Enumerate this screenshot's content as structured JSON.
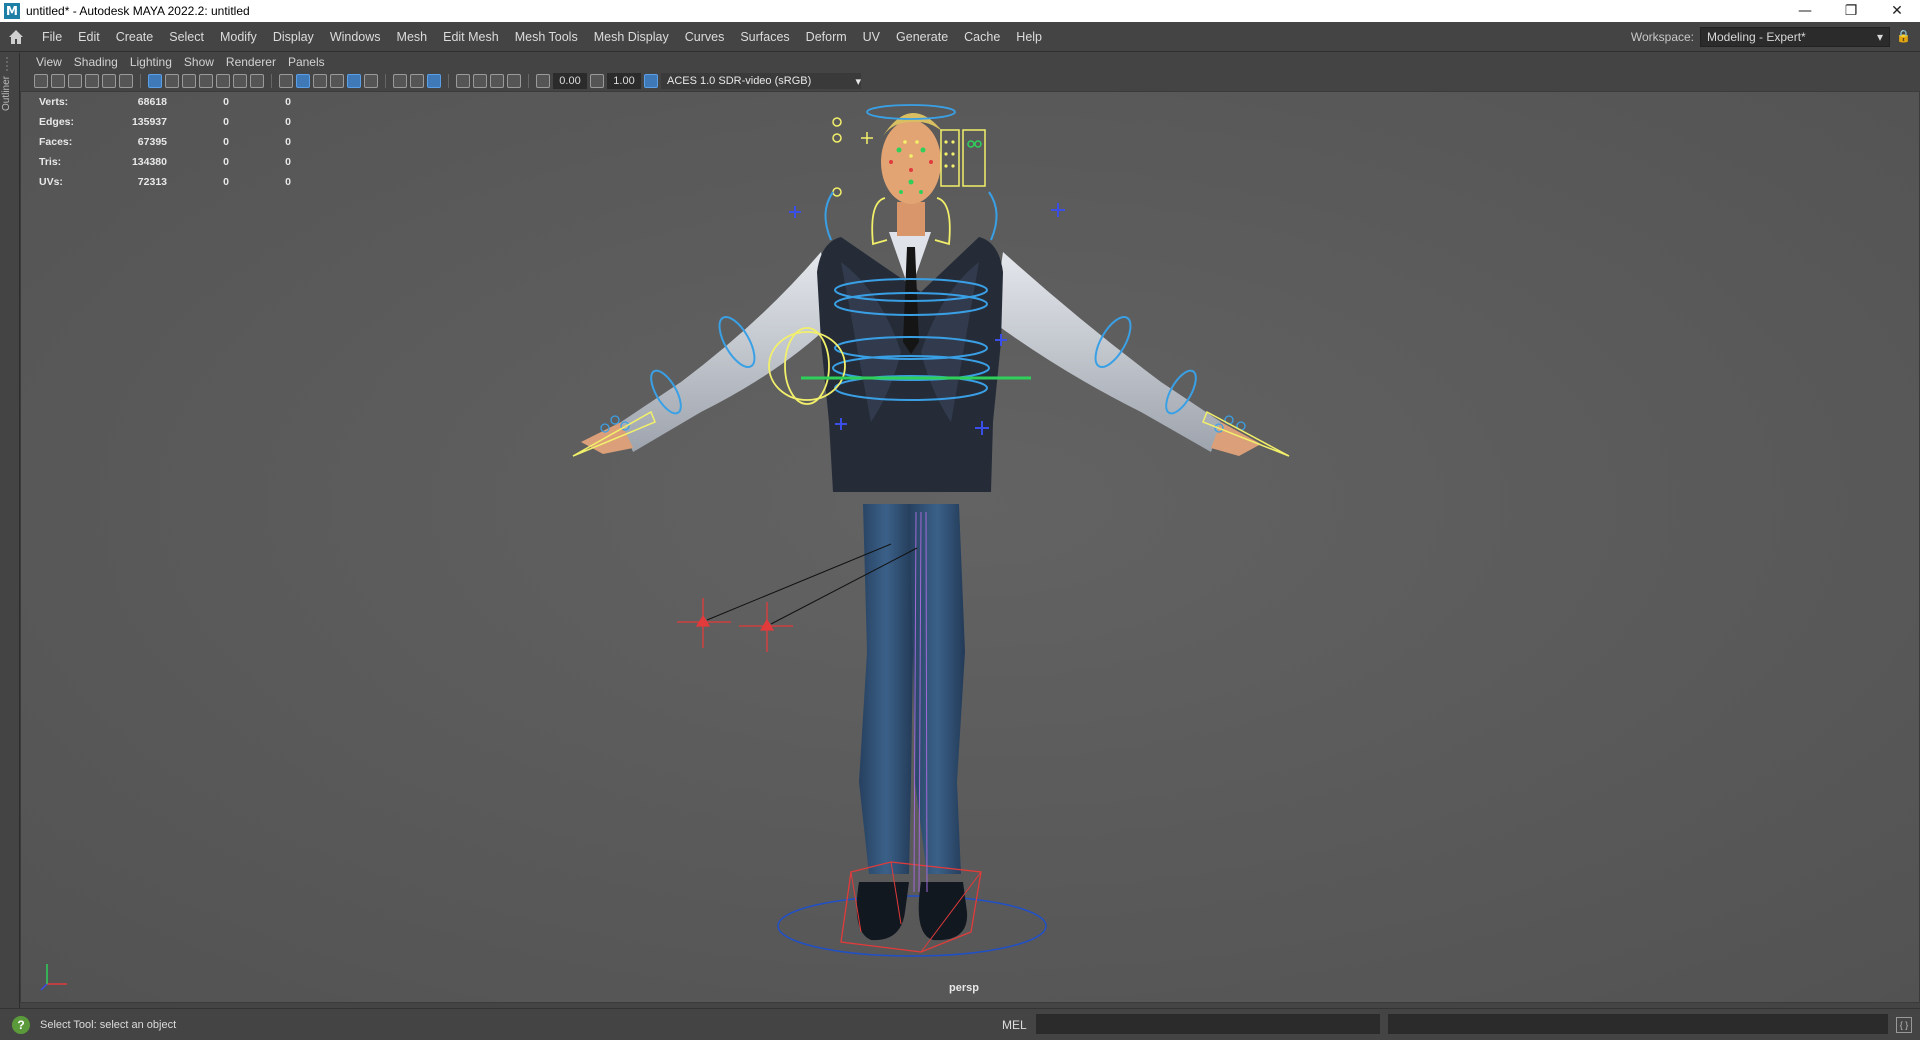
{
  "window": {
    "title": "untitled* - Autodesk MAYA 2022.2: untitled",
    "app_icon_letter": "M",
    "minimize_glyph": "—",
    "restore_glyph": "❐",
    "close_glyph": "✕"
  },
  "menubar": {
    "items": [
      "File",
      "Edit",
      "Create",
      "Select",
      "Modify",
      "Display",
      "Windows",
      "Mesh",
      "Edit Mesh",
      "Mesh Tools",
      "Mesh Display",
      "Curves",
      "Surfaces",
      "Deform",
      "UV",
      "Generate",
      "Cache",
      "Help"
    ],
    "workspace_label": "Workspace:",
    "workspace_value": "Modeling - Expert*"
  },
  "outliner": {
    "label": "Outliner"
  },
  "panel_menu": {
    "items": [
      "View",
      "Shading",
      "Lighting",
      "Show",
      "Renderer",
      "Panels"
    ]
  },
  "toolbar": {
    "exposure": "0.00",
    "gamma": "1.00",
    "color_space": "ACES 1.0 SDR-video (sRGB)"
  },
  "hud": {
    "rows": [
      {
        "label": "Verts:",
        "value": "68618",
        "a": "0",
        "b": "0"
      },
      {
        "label": "Edges:",
        "value": "135937",
        "a": "0",
        "b": "0"
      },
      {
        "label": "Faces:",
        "value": "67395",
        "a": "0",
        "b": "0"
      },
      {
        "label": "Tris:",
        "value": "134380",
        "a": "0",
        "b": "0"
      },
      {
        "label": "UVs:",
        "value": "72313",
        "a": "0",
        "b": "0"
      }
    ]
  },
  "viewport": {
    "camera": "persp"
  },
  "statusbar": {
    "help_glyph": "?",
    "message": "Select Tool: select an object",
    "mel_label": "MEL"
  },
  "colors": {
    "viewport_bg": "#5a5a5a",
    "ui_bg": "#444444",
    "control_blue": "#3aa0e6",
    "control_yellow": "#f2f06a",
    "control_red": "#e23b3b",
    "control_green": "#2fd05a",
    "jeans": "#2f4f78",
    "vest": "#2a3140",
    "shirt": "#c9ced6",
    "skin": "#e2a472"
  }
}
